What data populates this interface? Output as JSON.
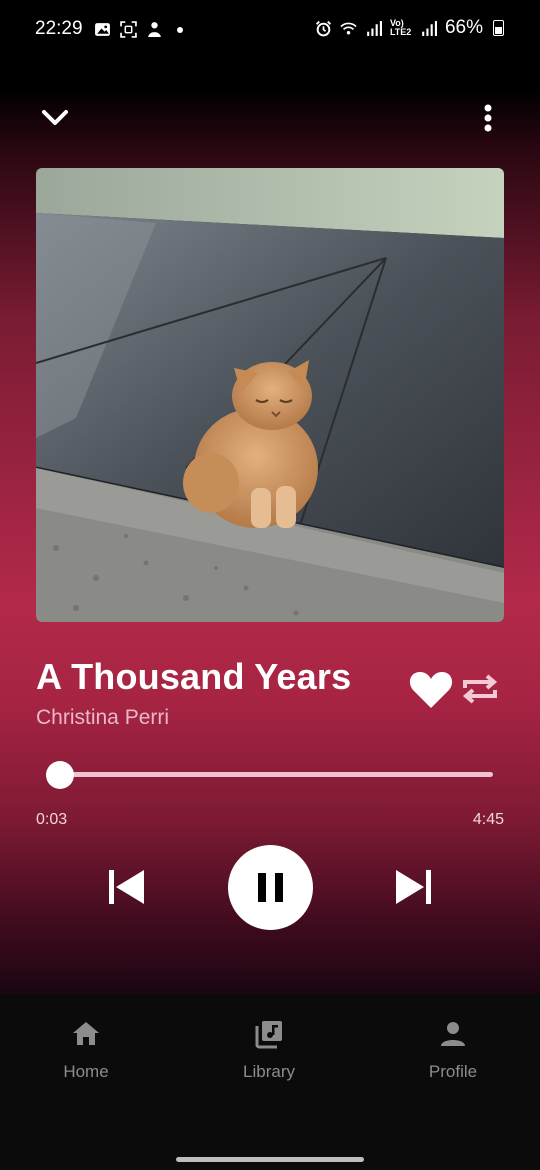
{
  "status_bar": {
    "time": "22:29",
    "network": "Vo) LTE2",
    "battery": "66%"
  },
  "now_playing": {
    "title": "A Thousand Years",
    "artist": "Christina Perri",
    "current_time": "0:03",
    "total_time": "4:45",
    "progress_fraction": 0.011,
    "liked": true,
    "artwork_description": "Orange cat sitting on dark stone memorial slab"
  },
  "controls": {
    "collapse_icon": "chevron-down-icon",
    "more_icon": "more-vertical-icon",
    "like_icon": "heart-icon",
    "repeat_icon": "repeat-icon",
    "prev_icon": "skip-previous-icon",
    "pause_icon": "pause-icon",
    "next_icon": "skip-next-icon"
  },
  "bottom_nav": {
    "items": [
      {
        "label": "Home",
        "icon": "home-icon"
      },
      {
        "label": "Library",
        "icon": "library-music-icon"
      },
      {
        "label": "Profile",
        "icon": "person-icon"
      }
    ]
  },
  "colors": {
    "accent_gradient_mid": "#b3294a",
    "nav_background": "#0b0b0b",
    "artist_text": "#e9b9c6"
  }
}
